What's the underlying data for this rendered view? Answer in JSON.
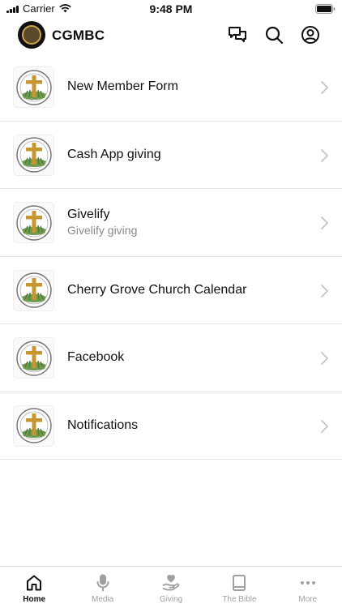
{
  "status_bar": {
    "carrier": "Carrier",
    "time": "9:48 PM"
  },
  "header": {
    "title": "CGMBC",
    "icons": [
      "chat-icon",
      "search-icon",
      "account-icon"
    ]
  },
  "list": [
    {
      "title": "New Member Form",
      "subtitle": ""
    },
    {
      "title": "Cash App giving",
      "subtitle": ""
    },
    {
      "title": "Givelify",
      "subtitle": "Givelify giving"
    },
    {
      "title": "Cherry Grove Church Calendar",
      "subtitle": ""
    },
    {
      "title": "Facebook",
      "subtitle": ""
    },
    {
      "title": "Notifications",
      "subtitle": ""
    }
  ],
  "tabs": [
    {
      "label": "Home",
      "icon": "home-icon",
      "active": true
    },
    {
      "label": "Media",
      "icon": "microphone-icon",
      "active": false
    },
    {
      "label": "Giving",
      "icon": "giving-hand-icon",
      "active": false
    },
    {
      "label": "The Bible",
      "icon": "book-icon",
      "active": false
    },
    {
      "label": "More",
      "icon": "more-dots-icon",
      "active": false
    }
  ],
  "colors": {
    "active_tab": "#111111",
    "inactive_tab": "#a0a0a0",
    "divider": "#e4e4e4",
    "subtitle": "#8a8a8a"
  }
}
